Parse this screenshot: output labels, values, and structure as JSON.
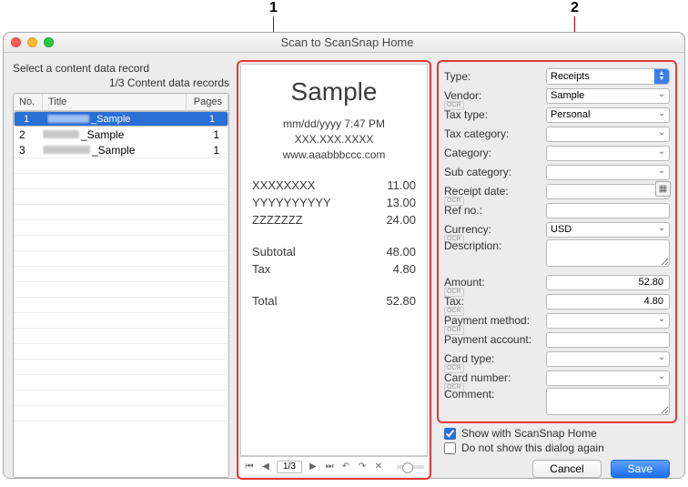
{
  "callouts": {
    "one": "1",
    "two": "2"
  },
  "window": {
    "title": "Scan to ScanSnap Home"
  },
  "left": {
    "heading": "Select a content data record",
    "counter": "1/3 Content data records",
    "cols": {
      "no": "No.",
      "title": "Title",
      "pages": "Pages"
    },
    "rows": [
      {
        "no": "1",
        "title_suffix": "_Sample",
        "pages": "1",
        "selected": true
      },
      {
        "no": "2",
        "title_suffix": "_Sample",
        "pages": "1",
        "selected": false
      },
      {
        "no": "3",
        "title_suffix": "_Sample",
        "pages": "1",
        "selected": false
      }
    ]
  },
  "receipt": {
    "title": "Sample",
    "datetime": "mm/dd/yyyy 7:47 PM",
    "phone": "XXX.XXX.XXXX",
    "site": "www.aaabbbccc.com",
    "lines": [
      {
        "name": "XXXXXXXX",
        "amt": "11.00"
      },
      {
        "name": "YYYYYYYYYY",
        "amt": "13.00"
      },
      {
        "name": "ZZZZZZZ",
        "amt": "24.00"
      }
    ],
    "subtotal_label": "Subtotal",
    "subtotal": "48.00",
    "tax_label": "Tax",
    "tax": "4.80",
    "total_label": "Total",
    "total": "52.80"
  },
  "pager": {
    "page_value": "1/3"
  },
  "form": {
    "type_label": "Type:",
    "type_value": "Receipts",
    "vendor_label": "Vendor:",
    "vendor_value": "Sample",
    "taxtype_label": "Tax type:",
    "taxtype_value": "Personal",
    "taxcat_label": "Tax category:",
    "taxcat_value": "",
    "category_label": "Category:",
    "category_value": "",
    "subcat_label": "Sub category:",
    "subcat_value": "",
    "recdate_label": "Receipt date:",
    "recdate_value": "",
    "refno_label": "Ref no.:",
    "refno_value": "",
    "currency_label": "Currency:",
    "currency_value": "USD",
    "desc_label": "Description:",
    "desc_value": "",
    "amount_label": "Amount:",
    "amount_value": "52.80",
    "tax_label": "Tax:",
    "tax_value": "4.80",
    "paym_label": "Payment method:",
    "paym_value": "",
    "paya_label": "Payment account:",
    "paya_value": "",
    "cardtype_label": "Card type:",
    "cardtype_value": "",
    "cardnum_label": "Card number:",
    "cardnum_value": "",
    "comment_label": "Comment:",
    "comment_value": ""
  },
  "footer": {
    "chk1": "Show with ScanSnap Home",
    "chk2": "Do not show this dialog again",
    "cancel": "Cancel",
    "save": "Save"
  }
}
